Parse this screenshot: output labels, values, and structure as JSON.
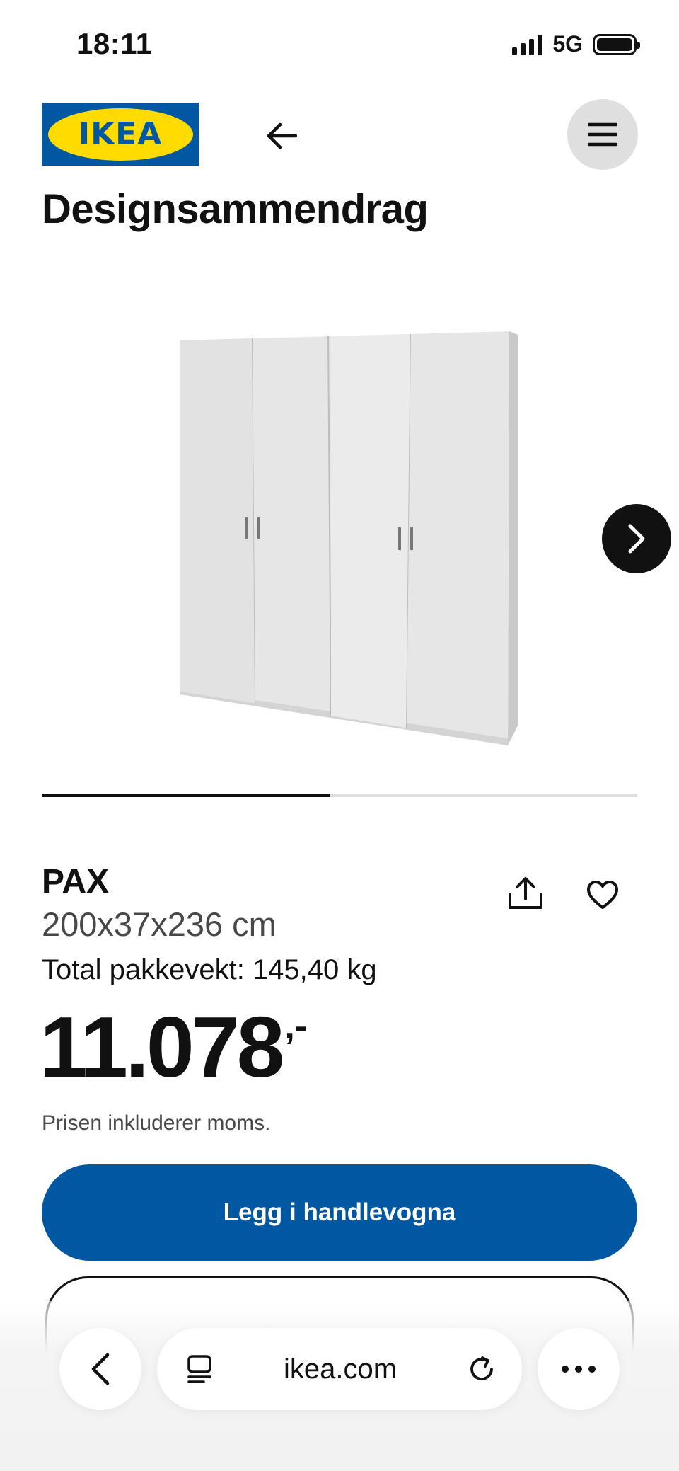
{
  "status_bar": {
    "time": "18:11",
    "network": "5G"
  },
  "header": {
    "logo_text": "IKEA"
  },
  "page": {
    "title": "Designsammendrag"
  },
  "gallery": {
    "progress_fraction": 0.485
  },
  "product": {
    "name": "PAX",
    "dimensions": "200x37x236 cm",
    "weight": "Total pakkevekt: 145,40 kg",
    "price_integer": "11.078",
    "price_decimal": ",-",
    "vat_note": "Prisen inkluderer moms."
  },
  "actions": {
    "add_to_cart": "Legg i handlevogna"
  },
  "browser": {
    "url": "ikea.com"
  },
  "colors": {
    "brand_blue": "#0058a3",
    "brand_yellow": "#ffdb00",
    "text": "#111111"
  }
}
